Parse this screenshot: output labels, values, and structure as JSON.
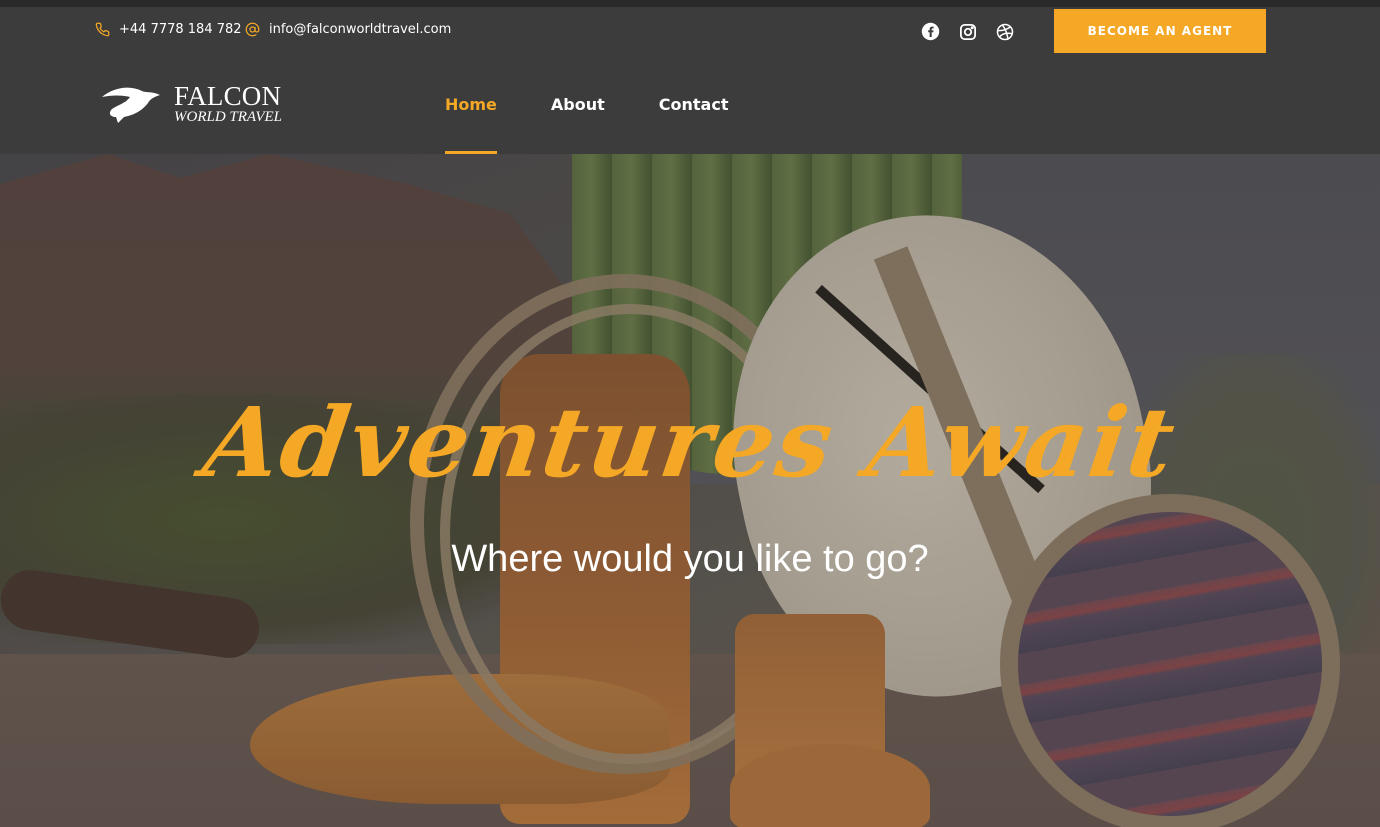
{
  "topbar": {
    "phone": "+44 7778 184 782",
    "email": "info@falconworldtravel.com",
    "social": [
      "facebook-icon",
      "instagram-icon",
      "dribbble-icon"
    ],
    "agent_button": "BECOME AN AGENT"
  },
  "logo": {
    "line1": "FALCON",
    "line2": "WORLD TRAVEL"
  },
  "nav": {
    "items": [
      "Home",
      "About",
      "Contact"
    ],
    "active": "Home"
  },
  "hero": {
    "title": "Adventures Await",
    "subtitle": "Where would you like to go?"
  },
  "colors": {
    "accent": "#f4a825",
    "header_bg": "#3c3c3c",
    "text": "#ffffff"
  }
}
